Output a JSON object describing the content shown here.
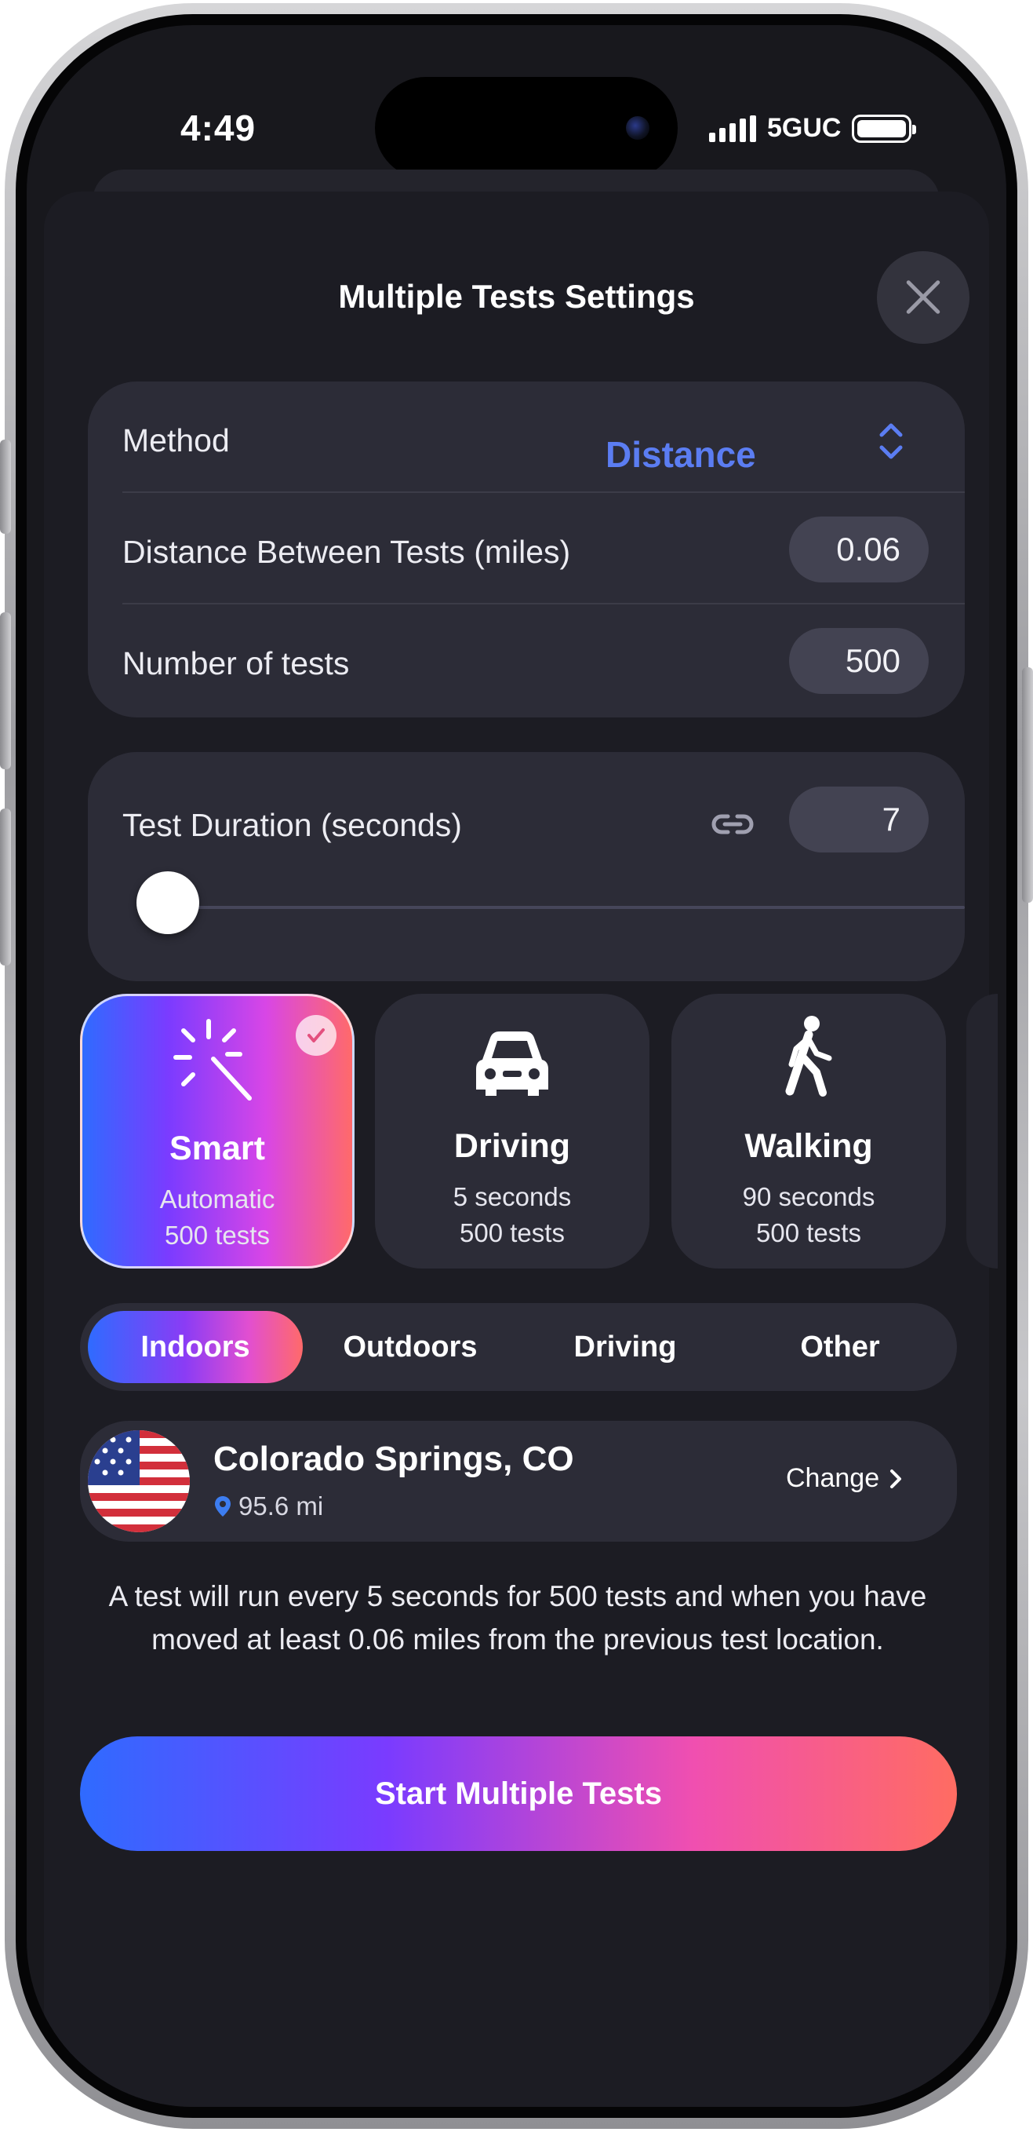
{
  "status_bar": {
    "time": "4:49",
    "network": "5GUC"
  },
  "sheet": {
    "title": "Multiple Tests Settings"
  },
  "method": {
    "label": "Method",
    "value": "Distance",
    "value_color": "#5b7df2"
  },
  "distance": {
    "label": "Distance Between Tests (miles)",
    "value": "0.06"
  },
  "number_of_tests": {
    "label": "Number of tests",
    "value": "500"
  },
  "duration": {
    "label": "Test Duration (seconds)",
    "value": "7",
    "slider_fraction": 0.0
  },
  "modes": [
    {
      "name": "Smart",
      "line1": "Automatic",
      "line2": "500 tests",
      "icon": "magic-wand-icon",
      "selected": true
    },
    {
      "name": "Driving",
      "line1": "5 seconds",
      "line2": "500 tests",
      "icon": "car-icon",
      "selected": false
    },
    {
      "name": "Walking",
      "line1": "90 seconds",
      "line2": "500 tests",
      "icon": "walking-person-icon",
      "selected": false
    }
  ],
  "environment_tabs": [
    {
      "label": "Indoors",
      "active": true
    },
    {
      "label": "Outdoors",
      "active": false
    },
    {
      "label": "Driving",
      "active": false
    },
    {
      "label": "Other",
      "active": false
    }
  ],
  "location": {
    "city": "Colorado Springs, CO",
    "distance": "95.6 mi",
    "change_label": "Change",
    "flag": "us-flag-icon"
  },
  "description": "A test will run every 5 seconds for 500 tests and when you have moved at least 0.06 miles from the previous test location.",
  "start_button": {
    "label": "Start Multiple Tests"
  },
  "colors": {
    "accent_gradient": [
      "#2f6bff",
      "#7a3bff",
      "#f04fb0",
      "#ff6c62"
    ],
    "card_background": "#2c2c37",
    "sheet_background": "#1c1c23"
  }
}
